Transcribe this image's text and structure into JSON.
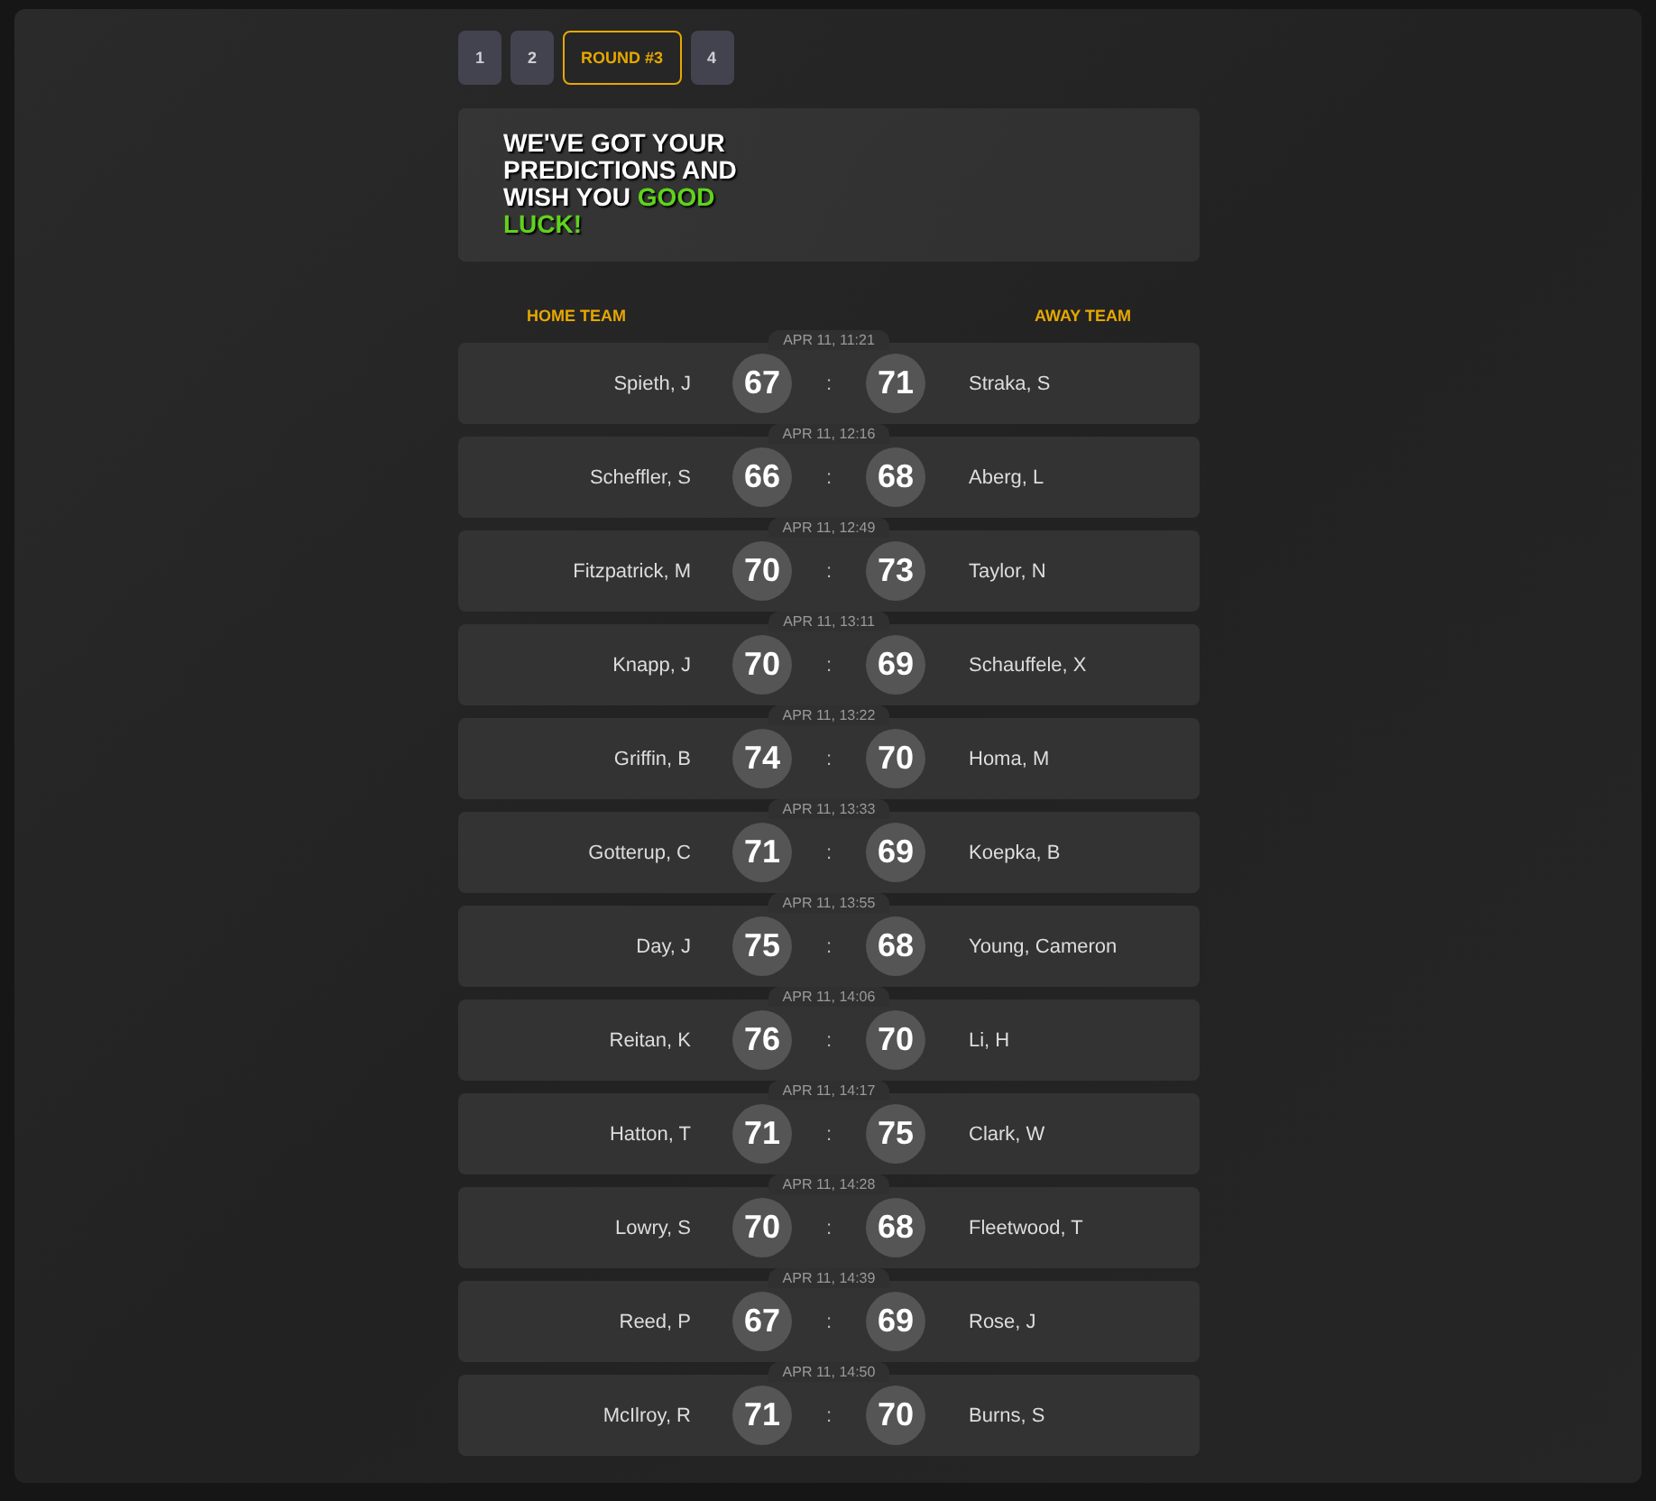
{
  "rounds": [
    {
      "label": "1",
      "selected": false
    },
    {
      "label": "2",
      "selected": false
    },
    {
      "label": "ROUND #3",
      "selected": true
    },
    {
      "label": "4",
      "selected": false
    }
  ],
  "banner": {
    "message": "WE'VE GOT YOUR PREDICTIONS AND WISH YOU",
    "highlight": "GOOD LUCK!"
  },
  "columns": {
    "home": "HOME TEAM",
    "away": "AWAY TEAM"
  },
  "matches": [
    {
      "time": "APR 11, 11:21",
      "home": "Spieth, J",
      "home_score": "67",
      "separator": ":",
      "away_score": "71",
      "away": "Straka, S"
    },
    {
      "time": "APR 11, 12:16",
      "home": "Scheffler, S",
      "home_score": "66",
      "separator": ":",
      "away_score": "68",
      "away": "Aberg, L"
    },
    {
      "time": "APR 11, 12:49",
      "home": "Fitzpatrick, M",
      "home_score": "70",
      "separator": ":",
      "away_score": "73",
      "away": "Taylor, N"
    },
    {
      "time": "APR 11, 13:11",
      "home": "Knapp, J",
      "home_score": "70",
      "separator": ":",
      "away_score": "69",
      "away": "Schauffele, X"
    },
    {
      "time": "APR 11, 13:22",
      "home": "Griffin, B",
      "home_score": "74",
      "separator": ":",
      "away_score": "70",
      "away": "Homa, M"
    },
    {
      "time": "APR 11, 13:33",
      "home": "Gotterup, C",
      "home_score": "71",
      "separator": ":",
      "away_score": "69",
      "away": "Koepka, B"
    },
    {
      "time": "APR 11, 13:55",
      "home": "Day, J",
      "home_score": "75",
      "separator": ":",
      "away_score": "68",
      "away": "Young, Cameron"
    },
    {
      "time": "APR 11, 14:06",
      "home": "Reitan, K",
      "home_score": "76",
      "separator": ":",
      "away_score": "70",
      "away": "Li, H"
    },
    {
      "time": "APR 11, 14:17",
      "home": "Hatton, T",
      "home_score": "71",
      "separator": ":",
      "away_score": "75",
      "away": "Clark, W"
    },
    {
      "time": "APR 11, 14:28",
      "home": "Lowry, S",
      "home_score": "70",
      "separator": ":",
      "away_score": "68",
      "away": "Fleetwood, T"
    },
    {
      "time": "APR 11, 14:39",
      "home": "Reed, P",
      "home_score": "67",
      "separator": ":",
      "away_score": "69",
      "away": "Rose, J"
    },
    {
      "time": "APR 11, 14:50",
      "home": "McIlroy, R",
      "home_score": "71",
      "separator": ":",
      "away_score": "70",
      "away": "Burns, S"
    }
  ]
}
